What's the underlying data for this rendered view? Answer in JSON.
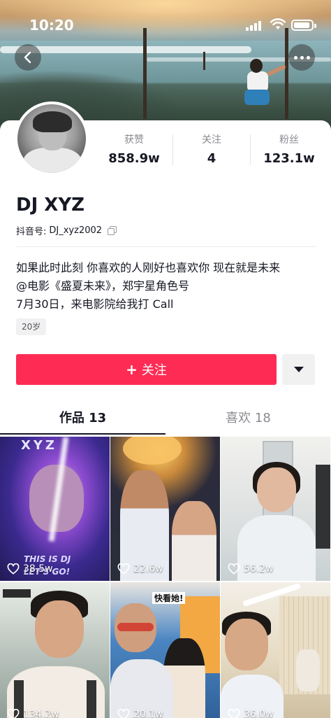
{
  "status_bar": {
    "time": "10:20"
  },
  "cover": {
    "nav_back_icon": "chevron-left-icon",
    "nav_more_icon": "more-dots-icon"
  },
  "profile": {
    "name": "DJ XYZ",
    "douyin_id_label": "抖音号:",
    "douyin_id": "DJ_xyz2002",
    "stats": [
      {
        "label": "获赞",
        "value": "858.9w"
      },
      {
        "label": "关注",
        "value": "4"
      },
      {
        "label": "粉丝",
        "value": "123.1w"
      }
    ],
    "bio_lines": [
      "如果此时此刻 你喜欢的人刚好也喜欢你 现在就是未来",
      "@电影《盛夏未来》，郑宇星角色号",
      "7月30日，来电影院给我打 Call"
    ],
    "tag": "20岁"
  },
  "actions": {
    "follow_label": "关注",
    "follow_plus": "+",
    "accent_color": "#fe2c55"
  },
  "tabs": [
    {
      "label": "作品 13",
      "active": true
    },
    {
      "label": "喜欢 18",
      "active": false
    }
  ],
  "videos": [
    {
      "likes": "38.5w",
      "overlay_title": "XYZ",
      "overlay_caption_1": "THIS IS DJ",
      "overlay_caption_2": "LET'S GO!"
    },
    {
      "likes": "22.6w"
    },
    {
      "likes": "56.2w"
    },
    {
      "likes": "134.2w"
    },
    {
      "likes": "20.1w",
      "overlay_banner": "快看她!"
    },
    {
      "likes": "36.0w"
    }
  ]
}
